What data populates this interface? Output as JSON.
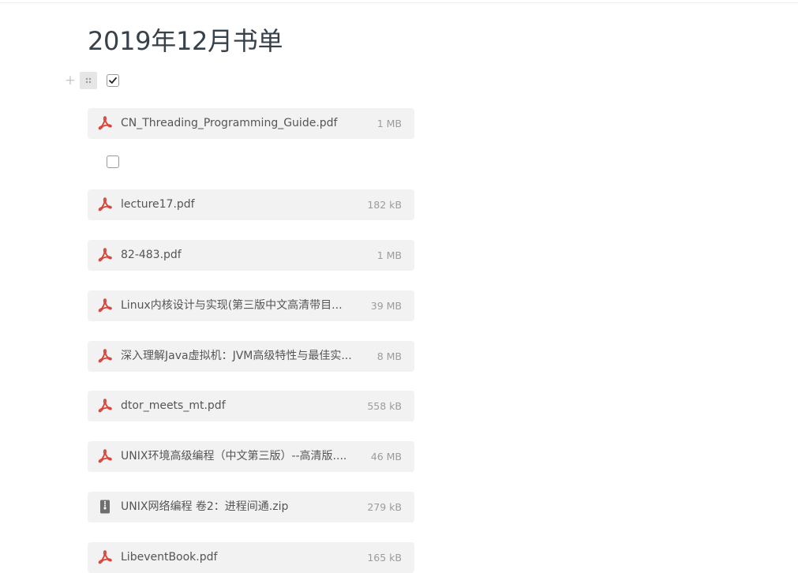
{
  "page": {
    "title": "2019年12月书单"
  },
  "block_tools": {
    "add_glyph": "+",
    "drag_icon": "drag-handle-icon"
  },
  "todos": [
    {
      "checked": true
    },
    {
      "checked": false
    }
  ],
  "files": [
    {
      "name": "CN_Threading_Programming_Guide.pdf",
      "size": "1 MB",
      "icon": "pdf-icon"
    },
    {
      "name": "lecture17.pdf",
      "size": "182 kB",
      "icon": "pdf-icon"
    },
    {
      "name": "82-483.pdf",
      "size": "1 MB",
      "icon": "pdf-icon"
    },
    {
      "name": "Linux内核设计与实现(第三版中文高清带目...",
      "size": "39 MB",
      "icon": "pdf-icon"
    },
    {
      "name": "深入理解Java虚拟机：JVM高级特性与最佳实...",
      "size": "8 MB",
      "icon": "pdf-icon"
    },
    {
      "name": "dtor_meets_mt.pdf",
      "size": "558 kB",
      "icon": "pdf-icon"
    },
    {
      "name": "UNIX环境高级编程（中文第三版）--高清版....",
      "size": "46 MB",
      "icon": "pdf-icon"
    },
    {
      "name": "UNIX网络编程 卷2：进程间通.zip",
      "size": "279 kB",
      "icon": "zip-icon"
    },
    {
      "name": "LibeventBook.pdf",
      "size": "165 kB",
      "icon": "pdf-icon"
    }
  ],
  "colors": {
    "pdf_red": "#d9453a",
    "zip_gray": "#6f6f6f",
    "card_bg": "#f2f2f2"
  }
}
